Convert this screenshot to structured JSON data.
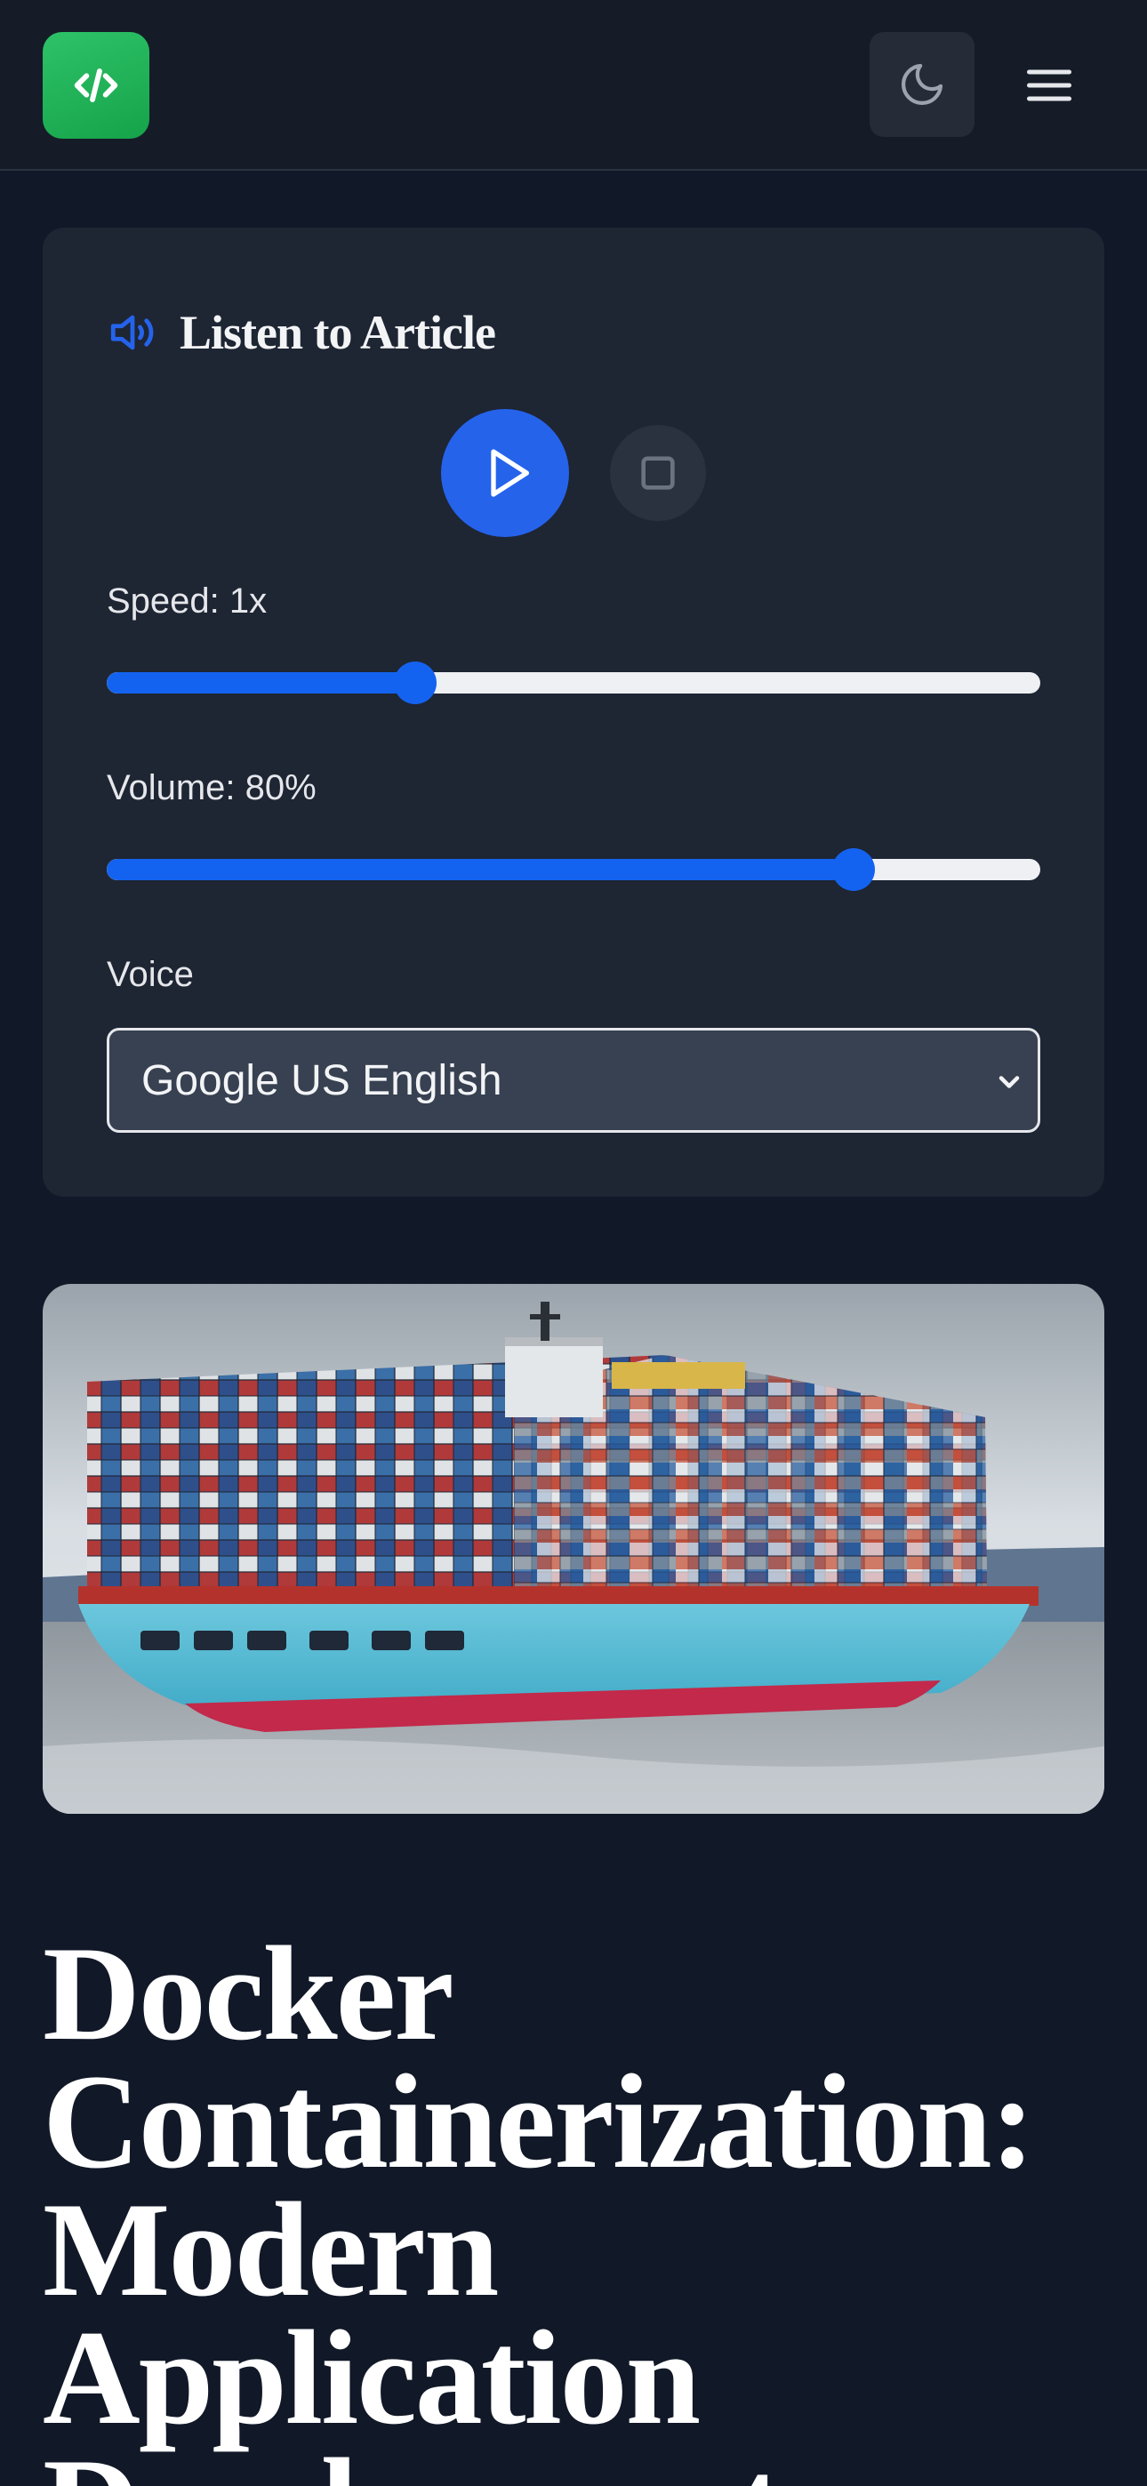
{
  "header": {
    "logo_icon": "code-icon",
    "theme_toggle_icon": "moon-icon",
    "menu_icon": "hamburger-menu-icon"
  },
  "audio_player": {
    "title": "Listen to Article",
    "title_icon": "speaker-icon",
    "play_icon": "play-icon",
    "stop_icon": "stop-icon",
    "speed_label": "Speed: 1x",
    "speed_level": 0.33,
    "volume_label": "Volume: 80%",
    "volume_level": 0.8,
    "voice_label": "Voice",
    "voice_selected": "Google US English"
  },
  "hero_image": {
    "alt": "Container ship loaded with shipping containers at sea"
  },
  "article": {
    "title": "Docker Containerization: Modern Application Development"
  },
  "colors": {
    "background": "#111827",
    "card": "#1e2533",
    "accent_blue": "#2563eb",
    "logo_green": "#22c55e"
  }
}
